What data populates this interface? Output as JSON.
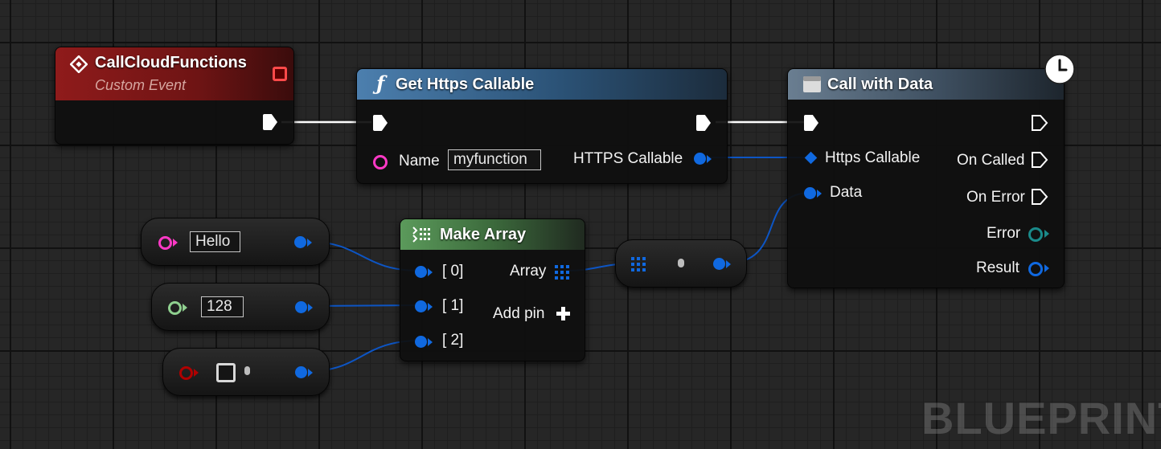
{
  "watermark": "BLUEPRINT",
  "nodes": {
    "call_cloud_functions": {
      "title": "CallCloudFunctions",
      "subtitle": "Custom Event",
      "icon": "event-diamond-icon",
      "header_color": "#7a1414"
    },
    "get_https_callable": {
      "title": "Get Https Callable",
      "icon": "function-icon",
      "header_color": "#2f5a80",
      "name_label": "Name",
      "name_value": "myfunction",
      "output_label": "HTTPS Callable"
    },
    "call_with_data": {
      "title": "Call with Data",
      "icon": "async-node-icon",
      "badge_icon": "clock-icon",
      "header_color": "#3a4a58",
      "inputs": [
        "Https Callable",
        "Data"
      ],
      "outputs": [
        "On Called",
        "On Error",
        "Error",
        "Result"
      ]
    },
    "make_array": {
      "title": "Make Array",
      "icon": "make-array-icon",
      "header_color": "#3c6a3c",
      "inputs": [
        "[ 0]",
        "[ 1]",
        "[ 2]"
      ],
      "output_label": "Array",
      "add_pin_label": "Add pin"
    }
  },
  "value_nodes": [
    {
      "type": "string",
      "value": "Hello",
      "pin_color": "#ff39c6"
    },
    {
      "type": "integer",
      "value": "128",
      "pin_color": "#8fd08f"
    },
    {
      "type": "boolean",
      "value": "",
      "pin_color": "#b00000"
    }
  ],
  "colors": {
    "wire_data": "#0d55c4",
    "wire_exec": "#ffffff",
    "pin_data": "#1069e0",
    "pin_string": "#ff39c6",
    "pin_error": "#1a8a8a",
    "pin_result": "#1069e0"
  }
}
